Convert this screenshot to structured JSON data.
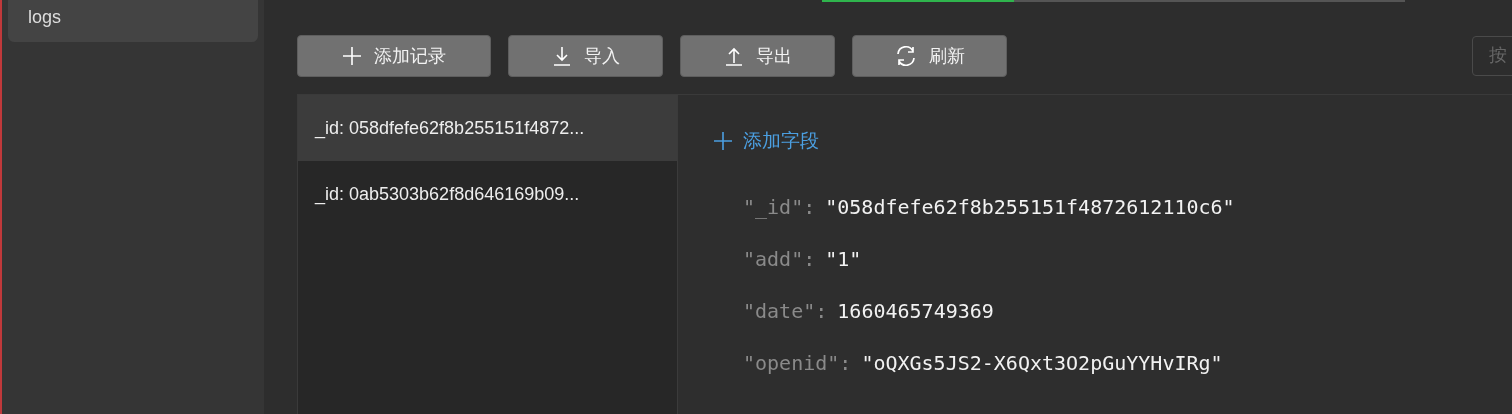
{
  "sidebar": {
    "items": [
      {
        "label": "logs",
        "selected": true
      }
    ]
  },
  "progress": {
    "level": 0.33
  },
  "toolbar": {
    "buttons": [
      {
        "kind": "add",
        "label": "添加记录"
      },
      {
        "kind": "import",
        "label": "导入"
      },
      {
        "kind": "export",
        "label": "导出"
      },
      {
        "kind": "refresh",
        "label": "刷新"
      }
    ],
    "search": {
      "placeholder": "按"
    }
  },
  "records": [
    {
      "label": "_id: 058dfefe62f8b255151f4872...",
      "selected": true
    },
    {
      "label": "_id: 0ab5303b62f8d646169b09...",
      "selected": false
    }
  ],
  "detail": {
    "add_field": "添加字段",
    "fields": [
      {
        "key": "\"_id\":",
        "value": "\"058dfefe62f8b255151f4872612110c6\""
      },
      {
        "key": "\"add\":",
        "value": "\"1\""
      },
      {
        "key": "\"date\":",
        "value": "1660465749369"
      },
      {
        "key": "\"openid\":",
        "value": "\"oQXGs5JS2-X6Qxt3O2pGuYYHvIRg\""
      }
    ]
  }
}
